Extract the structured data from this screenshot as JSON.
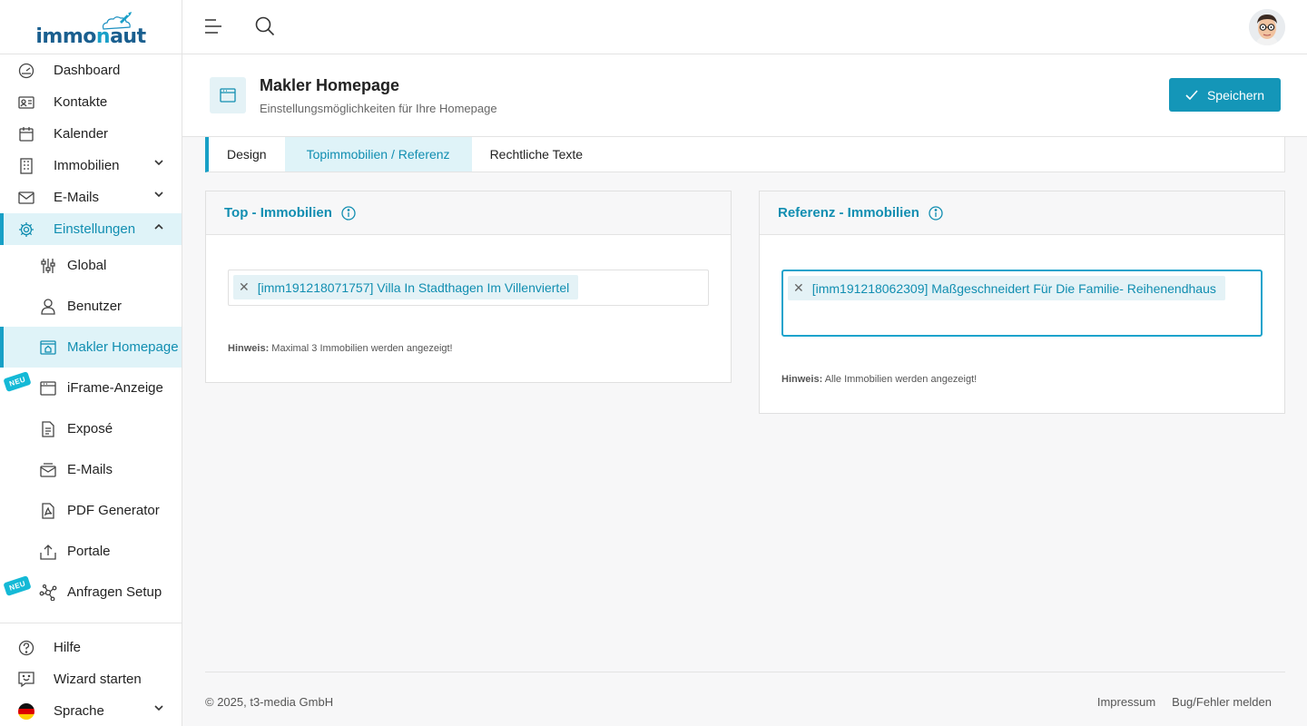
{
  "brand": {
    "logo_prefix": "immo",
    "logo_mid": "n",
    "logo_suffix": "aut"
  },
  "sidebar": {
    "items": [
      {
        "label": "Dashboard",
        "icon": "gauge-icon"
      },
      {
        "label": "Kontakte",
        "icon": "contact-card-icon"
      },
      {
        "label": "Kalender",
        "icon": "calendar-icon"
      },
      {
        "label": "Immobilien",
        "icon": "building-icon"
      },
      {
        "label": "E-Mails",
        "icon": "envelope-icon"
      },
      {
        "label": "Einstellungen",
        "icon": "gear-icon"
      }
    ],
    "sub_items": [
      {
        "label": "Global",
        "icon": "sliders-icon"
      },
      {
        "label": "Benutzer",
        "icon": "user-icon"
      },
      {
        "label": "Makler Homepage",
        "icon": "homepage-icon"
      },
      {
        "label": "iFrame-Anzeige",
        "icon": "browser-window-icon",
        "badge": "NEU"
      },
      {
        "label": "Exposé",
        "icon": "document-icon"
      },
      {
        "label": "E-Mails",
        "icon": "inbox-icon"
      },
      {
        "label": "PDF Generator",
        "icon": "pdf-icon"
      },
      {
        "label": "Portale",
        "icon": "upload-icon"
      },
      {
        "label": "Anfragen Setup",
        "icon": "network-icon",
        "badge": "NEU"
      }
    ],
    "bottom": [
      {
        "label": "Hilfe",
        "icon": "help-circle-icon"
      },
      {
        "label": "Wizard starten",
        "icon": "chat-smile-icon"
      },
      {
        "label": "Sprache",
        "icon": "german-flag-icon"
      }
    ]
  },
  "header": {
    "title": "Makler Homepage",
    "subtitle": "Einstellungsmöglichkeiten für Ihre Homepage",
    "save_label": "Speichern"
  },
  "tabs": [
    {
      "label": "Design"
    },
    {
      "label": "Topimmobilien / Referenz"
    },
    {
      "label": "Rechtliche Texte"
    }
  ],
  "top_card": {
    "title": "Top - Immobilien",
    "tag": "[imm191218071757] Villa In Stadthagen Im Villenviertel",
    "hint_label": "Hinweis:",
    "hint_text": "Maximal 3 Immobilien werden angezeigt!"
  },
  "ref_card": {
    "title": "Referenz - Immobilien",
    "tag": "[imm191218062309] Maßgeschneidert Für Die Familie- Reihenendhaus",
    "hint_label": "Hinweis:",
    "hint_text": "Alle Immobilien werden angezeigt!"
  },
  "footer": {
    "copyright": "© 2025, t3-media GmbH",
    "impressum": "Impressum",
    "bug": "Bug/Fehler melden"
  },
  "colors": {
    "accent": "#18a0c6",
    "accent_text": "#118eb1",
    "active_bg": "#dff3f8",
    "button": "#1496b8"
  }
}
